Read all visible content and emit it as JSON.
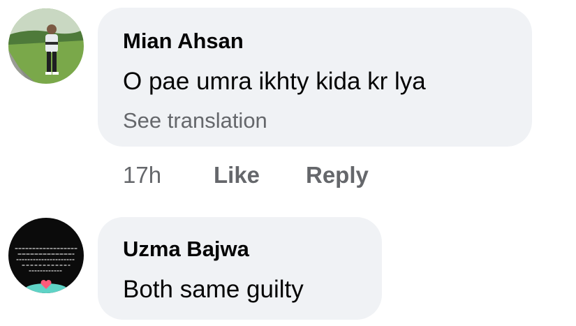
{
  "comments": [
    {
      "author": "Mian Ahsan",
      "text": "O pae umra ikhty kida kr lya",
      "translate_label": "See translation",
      "time": "17h",
      "like_label": "Like",
      "reply_label": "Reply"
    },
    {
      "author": "Uzma Bajwa",
      "text": "Both same guilty"
    }
  ],
  "colors": {
    "bubble_bg": "#f0f2f5",
    "secondary_text": "#65676b",
    "primary_text": "#050505"
  }
}
